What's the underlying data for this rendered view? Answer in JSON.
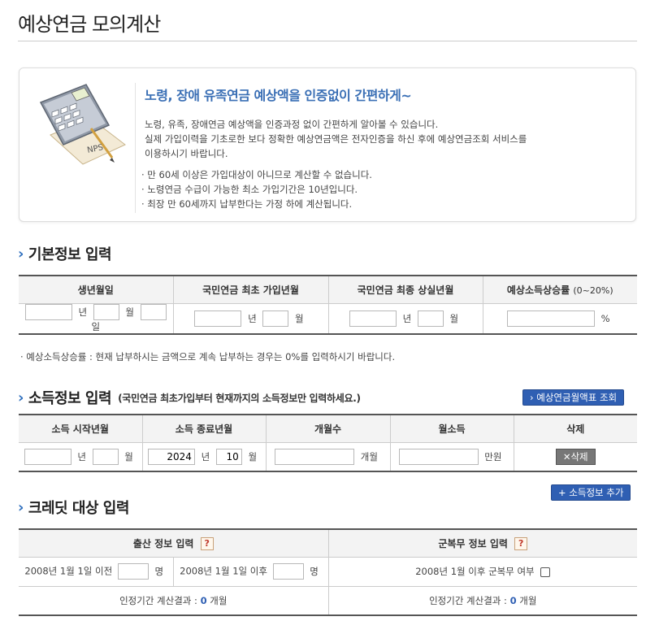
{
  "page": {
    "title": "예상연금 모의계산"
  },
  "intro": {
    "heading": "노령, 장애 유족연금 예상액을 인증없이 간편하게~",
    "lines": [
      "노령, 유족, 장애연금 예상액을 인증과정 없이 간편하게 알아볼 수 있습니다.",
      "실제 가입이력을 기초로한 보다 정확한 예상연금액은 전자인증을 하신 후에 예상연금조회 서비스를",
      "이용하시기 바랍니다."
    ],
    "bullets": [
      "· 만 60세 이상은 가입대상이 아니므로 계산할 수 없습니다.",
      "· 노령연금 수급이 가능한 최소 가입기간은 10년입니다.",
      "· 최장 만 60세까지 납부한다는 가정 하에 계산됩니다."
    ],
    "illustration_label": "NPS"
  },
  "basic": {
    "title": "기본정보 입력",
    "headers": [
      "생년월일",
      "국민연금 최초 가입년월",
      "국민연금 최종 상실년월",
      "예상소득상승률"
    ],
    "rate_range": "(0~20%)",
    "units": {
      "year": "년",
      "month": "월",
      "day": "일",
      "percent": "%"
    }
  },
  "note": "· 예상소득상승률 : 현재 납부하시는 금액으로 계속 납부하는 경우는 0%를 입력하시기 바랍니다.",
  "income": {
    "title": "소득정보 입력",
    "subtitle": "(국민연금 최초가입부터 현재까지의 소득정보만 입력하세요.)",
    "lookup_button": "› 예상연금월액표 조회",
    "headers": [
      "소득 시작년월",
      "소득 종료년월",
      "개월수",
      "월소득",
      "삭제"
    ],
    "end_year": "2024",
    "end_month": "10",
    "unit_months": "개월",
    "unit_money": "만원",
    "delete_button": "✕삭제",
    "add_button": "+ 소득정보 추가"
  },
  "credit": {
    "title": "크레딧 대상 입력",
    "birth_header": "출산 정보 입력",
    "military_header": "군복무 정보 입력",
    "help_icon": "?",
    "before_label": "2008년 1월 1일 이전",
    "after_label": "2008년 1월 1일 이후",
    "person_unit": "명",
    "military_label": "2008년 1월 이후 군복무 여부",
    "result_label": "인정기간 계산결과 :",
    "result_value": "0",
    "result_unit": "개월"
  }
}
